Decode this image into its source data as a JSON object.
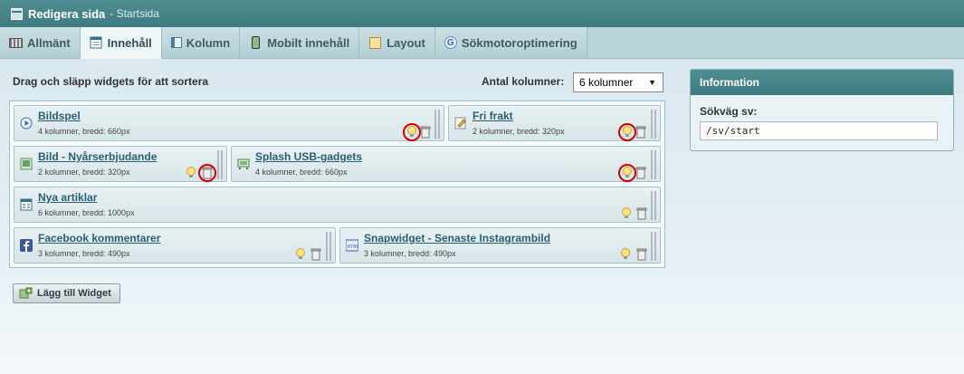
{
  "titlebar": {
    "title": "Redigera sida",
    "subtitle": "- Startsida"
  },
  "tabs": [
    {
      "label": "Allmänt",
      "icon": "grid-icon"
    },
    {
      "label": "Innehåll",
      "icon": "content-icon"
    },
    {
      "label": "Kolumn",
      "icon": "column-icon"
    },
    {
      "label": "Mobilt innehåll",
      "icon": "mobile-icon"
    },
    {
      "label": "Layout",
      "icon": "layout-icon"
    },
    {
      "label": "Sökmotoroptimering",
      "icon": "google-icon"
    }
  ],
  "main": {
    "instructions": "Drag och släpp widgets för att sortera",
    "column_count_label": "Antal kolumner:",
    "column_count_value": "6 kolumner"
  },
  "widgets": [
    {
      "name": "Bildspel",
      "info": "4 kolumner, bredd: 660px",
      "icon": "slideshow-icon"
    },
    {
      "name": "Fri frakt",
      "info": "2 kolumner, bredd: 320px",
      "icon": "text-edit-icon"
    },
    {
      "name": "Bild - Nyårserbjudande",
      "info": "2 kolumner, bredd: 320px",
      "icon": "image-icon"
    },
    {
      "name": "Splash USB-gadgets",
      "info": "4 kolumner, bredd: 660px",
      "icon": "splash-icon"
    },
    {
      "name": "Nya artiklar",
      "info": "6 kolumner, bredd: 1000px",
      "icon": "articles-icon"
    },
    {
      "name": "Facebook kommentarer",
      "info": "3 kolumner, bredd: 490px",
      "icon": "facebook-icon"
    },
    {
      "name": "Snapwidget - Senaste Instagrambild",
      "info": "3 kolumner, bredd: 490px",
      "icon": "html-icon"
    }
  ],
  "add_widget_label": "Lägg till Widget",
  "info_panel": {
    "title": "Information",
    "path_label": "Sökväg sv:",
    "path_value": "/sv/start"
  },
  "colors": {
    "header": "#3e7b80",
    "link": "#2b5f75",
    "highlight_circle": "#d40000"
  }
}
